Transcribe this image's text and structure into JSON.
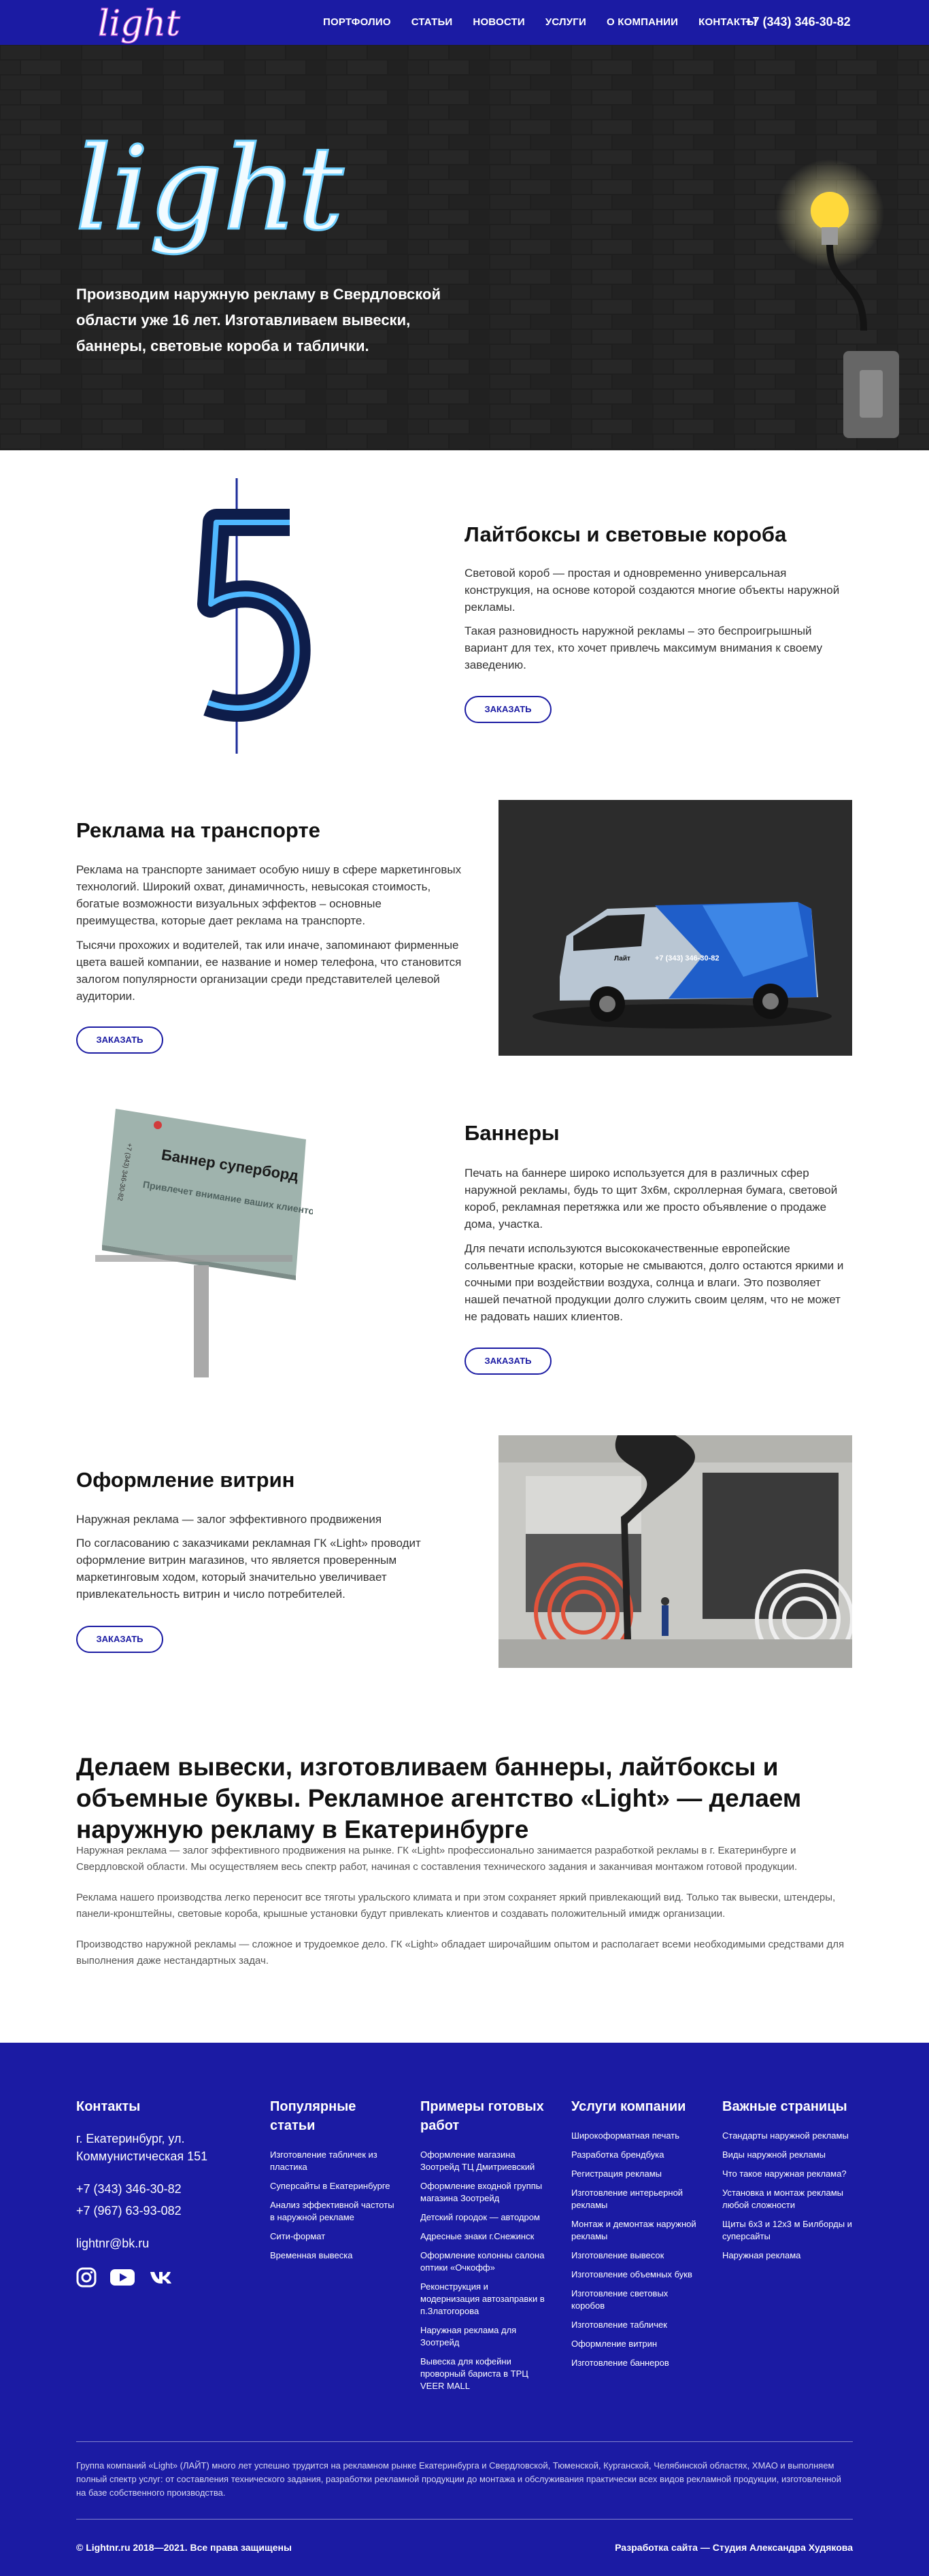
{
  "header": {
    "logo_text": "light",
    "nav": [
      "ПОРТФОЛИО",
      "СТАТЬИ",
      "НОВОСТИ",
      "УСЛУГИ",
      "О КОМПАНИИ",
      "КОНТАКТЫ"
    ],
    "phone": "+7 (343) 346-30-82"
  },
  "hero": {
    "logo_text": "light",
    "tagline": "Производим наружную рекламу в Свердловской области уже 16 лет. Изготавливаем вывески, баннеры, световые короба и таблички."
  },
  "sections": [
    {
      "title": "Лайтбоксы и световые короба",
      "paragraphs": [
        "Световой короб — простая и одновременно универсальная конструкция, на основе которой создаются многие объекты наружной рекламы.",
        "Такая разновидность наружной рекламы – это беспроигрышный вариант для тех, кто хочет привлечь максимум внимания к своему заведению."
      ],
      "button": "ЗАКАЗАТЬ",
      "image_icon": "neon-number-five"
    },
    {
      "title": "Реклама на транспорте",
      "paragraphs": [
        "Реклама на транспорте занимает особую нишу в сфере маркетинговых технологий. Широкий охват, динамичность, невысокая стоимость, богатые возможности визуальных эффектов – основные преимущества, которые дает реклама на транспорте.",
        "Тысячи прохожих и водителей, так или иначе, запоминают фирменные цвета вашей компании, ее название и номер телефона, что становится залогом популярности организации среди представителей целевой аудитории."
      ],
      "button": "ЗАКАЗАТЬ",
      "image_icon": "branded-van",
      "van_text": "+7 (343) 346-30-82",
      "van_logo": "Лайт"
    },
    {
      "title": "Баннеры",
      "paragraphs": [
        "Печать на баннере широко используется для в различных сфер наружной рекламы, будь то щит 3х6м, скроллерная бумага, световой короб, рекламная перетяжка или же просто объявление о продаже дома, участка.",
        "Для печати используются высококачественные европейские сольвентные краски, которые не смываются, долго остаются яркими и сочными при воздействии воздуха, солнца и влаги. Это позволяет нашей печатной продукции долго служить своим целям, что не может не радовать наших клиентов."
      ],
      "button": "ЗАКАЗАТЬ",
      "image_icon": "billboard",
      "billboard_title": "Баннер суперборд",
      "billboard_sub": "Привлечет внимание ваших клиентов",
      "billboard_phone": "+7 (343) 346-30-82"
    },
    {
      "title": "Оформление витрин",
      "paragraphs": [
        "Наружная реклама — залог эффективного продвижения",
        "По согласованию с заказчиками рекламная ГК «Light» проводит оформление витрин магазинов, что является проверенным маркетинговым ходом, который значительно увеличивает привлекательность витрин и число потребителей."
      ],
      "button": "ЗАКАЗАТЬ",
      "image_icon": "shop-window-street"
    }
  ],
  "seo": {
    "title": "Делаем вывески, изготовливаем баннеры, лайтбоксы и объемные буквы. Рекламное агентство «Light» — делаем наружную рекламу в Екатеринбурге",
    "paragraphs": [
      "Наружная реклама — залог эффективного продвижения на рынке. ГК «Light» профессионально занимается разработкой рекламы в г. Екатеринбурге и Свердловской области. Мы осуществляем весь спектр работ, начиная с составления технического задания и заканчивая монтажом готовой продукции.",
      "Реклама нашего производства легко переносит все тяготы уральского климата и при этом сохраняет яркий привлекающий вид. Только так вывески, штендеры, панели-кронштейны, световые короба, крышные установки будут привлекать клиентов и создавать положительный имидж организации.",
      "Производство наружной рекламы — сложное и трудоемкое дело. ГК «Light» обладает широчайшим опытом и располагает всеми необходимыми средствами для выполнения даже нестандартных задач."
    ]
  },
  "footer": {
    "contacts": {
      "title": "Контакты",
      "address": "г. Екатеринбург, ул. Коммунистическая 151",
      "phone1": "+7 (343) 346-30-82",
      "phone2": "+7 (967) 63-93-082",
      "email": "lightnr@bk.ru"
    },
    "columns": [
      {
        "title": "Популярные статьи",
        "items": [
          "Изготовление табличек из пластика",
          "Суперсайты в Екатеринбурге",
          "Анализ эффективной частоты в наружной рекламе",
          "Сити-формат",
          "Временная вывеска"
        ]
      },
      {
        "title": "Примеры готовых работ",
        "items": [
          "Оформление магазина Зоотрейд ТЦ Дмитриевский",
          "Оформление входной группы магазина Зоотрейд",
          "Детский городок — автодром",
          "Адресные знаки г.Снежинск",
          "Оформление колонны салона оптики «Очкофф»",
          "Реконструкция и модернизация автозаправки в п.Златогорова",
          "Наружная реклама для Зоотрейд",
          "Вывеска для кофейни проворный бариста в ТРЦ VEER MALL"
        ]
      },
      {
        "title": "Услуги компании",
        "items": [
          "Широкоформатная печать",
          "Разработка брендбука",
          "Регистрация рекламы",
          "Изготовление интерьерной рекламы",
          "Монтаж и демонтаж наружной рекламы",
          "Изготовление вывесок",
          "Изготовление объемных букв",
          "Изготовление световых коробов",
          "Изготовление табличек",
          "Оформление витрин",
          "Изготовление баннеров"
        ]
      },
      {
        "title": "Важные страницы",
        "items": [
          "Стандарты наружной рекламы",
          "Виды наружной рекламы",
          "Что такое наружная реклама?",
          "Установка и монтаж рекламы любой сложности",
          "Щиты 6х3 и 12х3 м Билборды и суперсайты",
          "Наружная реклама"
        ]
      }
    ],
    "about": "Группа компаний «Light» (ЛАЙТ) много лет успешно трудится на рекламном рынке Екатеринбурга и Свердловской, Тюменской, Курганской, Челябинской областях, ХМАО и выполняем полный спектр услуг: от составления технического задания, разработки рекламной продукции до монтажа и обслуживания практически всех видов рекламной продукции, изготовленной на базе собственного производства.",
    "copyright": "© Lightnr.ru 2018—2021. Все права защищены",
    "dev": "Разработка сайта — Студия Александра Худякова"
  },
  "colors": {
    "brand": "#1b1ba3",
    "neon": "#5ec8ff",
    "bulb": "#ffd93b"
  }
}
